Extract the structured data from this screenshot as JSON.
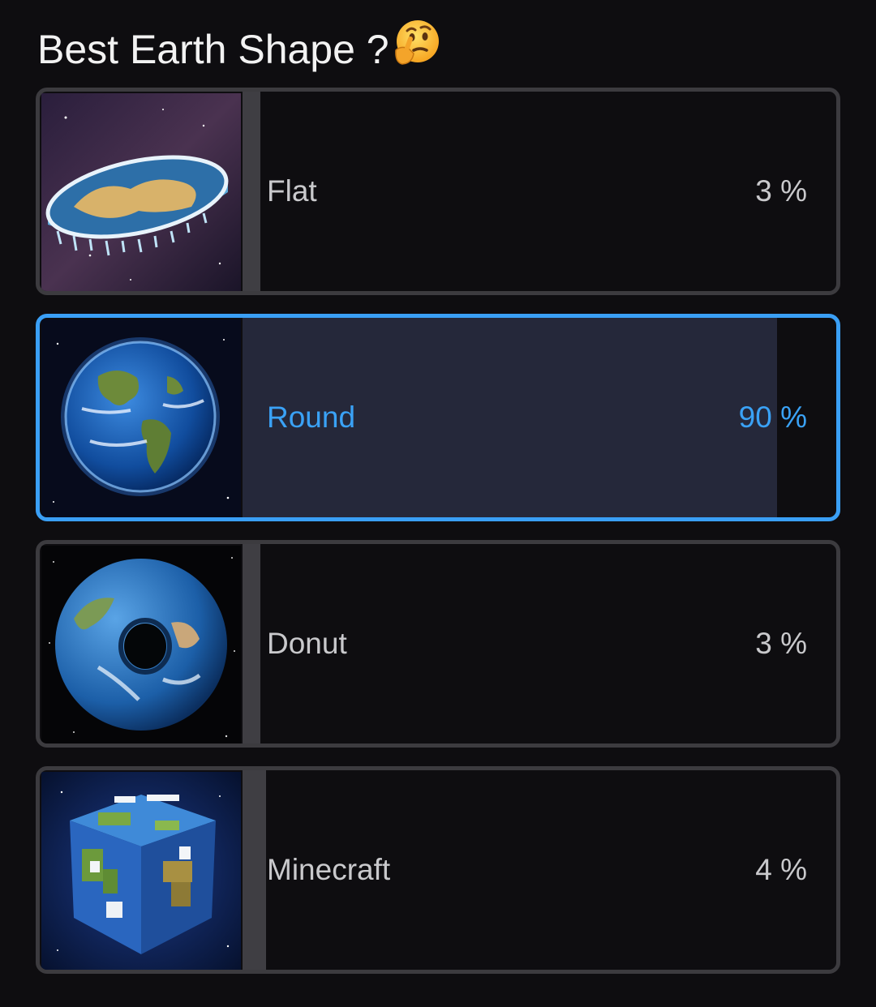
{
  "poll": {
    "title": "Best Earth Shape ?",
    "title_emoji": "thinking-face-emoji",
    "accent_color": "#3a9ff5",
    "options": [
      {
        "label": "Flat",
        "percent_text": "3 %",
        "percent": 3,
        "image": "flat-earth-image",
        "selected": false
      },
      {
        "label": "Round",
        "percent_text": "90 %",
        "percent": 90,
        "image": "round-earth-image",
        "selected": true
      },
      {
        "label": "Donut",
        "percent_text": "3 %",
        "percent": 3,
        "image": "donut-earth-image",
        "selected": false
      },
      {
        "label": "Minecraft",
        "percent_text": "4 %",
        "percent": 4,
        "image": "minecraft-earth-image",
        "selected": false
      }
    ]
  }
}
